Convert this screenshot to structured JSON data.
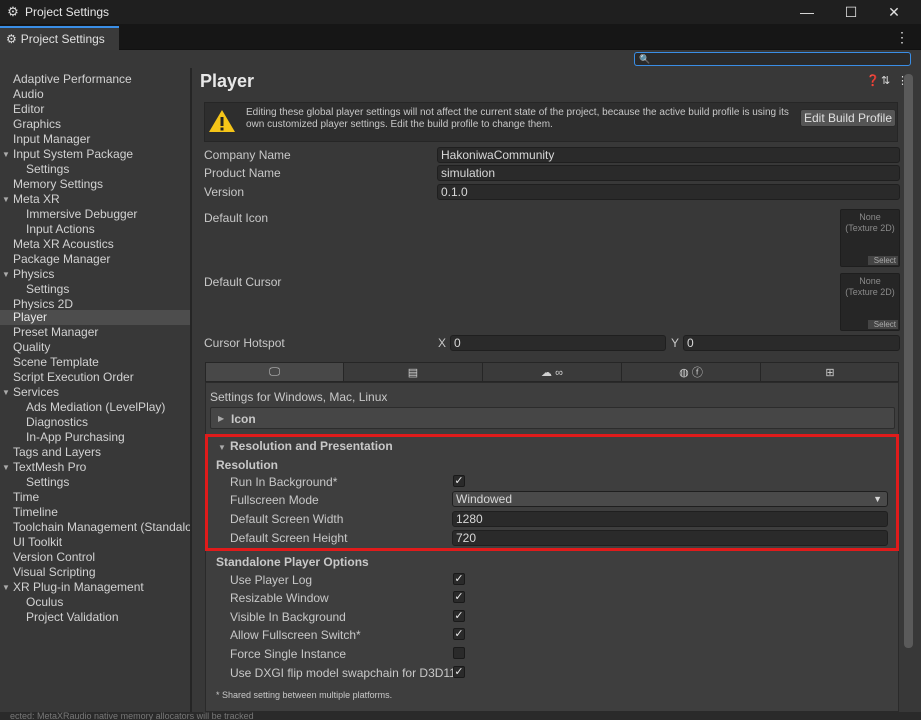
{
  "window": {
    "title": "Project Settings",
    "min": "—",
    "max": "☐",
    "close": "✕"
  },
  "tabs": [
    {
      "label": "Project Settings"
    }
  ],
  "search": {
    "value": "",
    "placeholder": ""
  },
  "sidebar": {
    "items": [
      {
        "label": "Adaptive Performance"
      },
      {
        "label": "Audio"
      },
      {
        "label": "Editor"
      },
      {
        "label": "Graphics"
      },
      {
        "label": "Input Manager"
      },
      {
        "label": "Input System Package"
      },
      {
        "label": "Settings"
      },
      {
        "label": "Memory Settings"
      },
      {
        "label": "Meta XR"
      },
      {
        "label": "Immersive Debugger"
      },
      {
        "label": "Input Actions"
      },
      {
        "label": "Meta XR Acoustics"
      },
      {
        "label": "Package Manager"
      },
      {
        "label": "Physics"
      },
      {
        "label": "Settings"
      },
      {
        "label": "Physics 2D"
      },
      {
        "label": "Player"
      },
      {
        "label": "Preset Manager"
      },
      {
        "label": "Quality"
      },
      {
        "label": "Scene Template"
      },
      {
        "label": "Script Execution Order"
      },
      {
        "label": "Services"
      },
      {
        "label": "Ads Mediation (LevelPlay)"
      },
      {
        "label": "Diagnostics"
      },
      {
        "label": "In-App Purchasing"
      },
      {
        "label": "Tags and Layers"
      },
      {
        "label": "TextMesh Pro"
      },
      {
        "label": "Settings"
      },
      {
        "label": "Time"
      },
      {
        "label": "Timeline"
      },
      {
        "label": "Toolchain Management (Standalo"
      },
      {
        "label": "UI Toolkit"
      },
      {
        "label": "Version Control"
      },
      {
        "label": "Visual Scripting"
      },
      {
        "label": "XR Plug-in Management"
      },
      {
        "label": "Oculus"
      },
      {
        "label": "Project Validation"
      }
    ]
  },
  "player": {
    "title": "Player",
    "warning_line1": "Editing these global player settings will not affect the current state of the project, because the active build profile is using its",
    "warning_line2": "own customized player settings. Edit the build profile to change them.",
    "edit_build_profile": "Edit Build Profile",
    "company_name_label": "Company Name",
    "company_name": "HakoniwaCommunity",
    "product_name_label": "Product Name",
    "product_name": "simulation",
    "version_label": "Version",
    "version": "0.1.0",
    "default_icon_label": "Default Icon",
    "default_cursor_label": "Default Cursor",
    "object_none": "None",
    "object_type": "(Texture 2D)",
    "object_select": "Select",
    "cursor_hotspot_label": "Cursor Hotspot",
    "x_label": "X",
    "x_value": "0",
    "y_label": "Y",
    "y_value": "0"
  },
  "platform": {
    "settings_for": "Settings for Windows, Mac, Linux",
    "icon_section": "Icon",
    "res_section": "Resolution and Presentation",
    "resolution_header": "Resolution",
    "run_in_background_label": "Run In Background*",
    "run_in_background": true,
    "fullscreen_mode_label": "Fullscreen Mode",
    "fullscreen_mode": "Windowed",
    "screen_width_label": "Default Screen Width",
    "screen_width": "1280",
    "screen_height_label": "Default Screen Height",
    "screen_height": "720",
    "standalone_header": "Standalone Player Options",
    "use_player_log_label": "Use Player Log",
    "resizable_window_label": "Resizable Window",
    "visible_in_background_label": "Visible In Background",
    "allow_fullscreen_switch_label": "Allow Fullscreen Switch*",
    "force_single_instance_label": "Force Single Instance",
    "dxgi_label": "Use DXGI flip model swapchain for D3D11",
    "shared_note": "* Shared setting between multiple platforms."
  },
  "status": {
    "ghost": "ected: MetaXRaudio native memory allocators will be tracked"
  },
  "colors": {
    "accent": "#3a8ee6",
    "highlight": "#e01b1b",
    "warning": "#f5c518"
  }
}
